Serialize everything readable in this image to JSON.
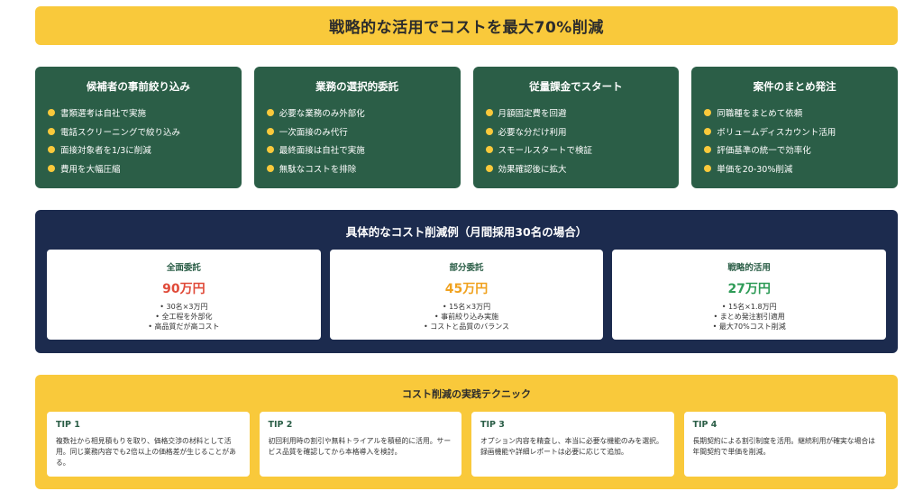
{
  "banner": {
    "title": "戦略的な活用でコストを最大70%削減"
  },
  "strategies": [
    {
      "title": "候補者の事前絞り込み",
      "items": [
        "書類選考は自社で実施",
        "電話スクリーニングで絞り込み",
        "面接対象者を1/3に削減",
        "費用を大幅圧縮"
      ]
    },
    {
      "title": "業務の選択的委託",
      "items": [
        "必要な業務のみ外部化",
        "一次面接のみ代行",
        "最終面接は自社で実施",
        "無駄なコストを排除"
      ]
    },
    {
      "title": "従量課金でスタート",
      "items": [
        "月額固定費を回避",
        "必要な分だけ利用",
        "スモールスタートで検証",
        "効果確認後に拡大"
      ]
    },
    {
      "title": "案件のまとめ発注",
      "items": [
        "同職種をまとめて依頼",
        "ボリュームディスカウント活用",
        "評価基準の統一で効率化",
        "単価を20-30%削減"
      ]
    }
  ],
  "examples": {
    "title": "具体的なコスト削減例（月間採用30名の場合）",
    "cards": [
      {
        "label": "全面委託",
        "price": "90万円",
        "price_color": "#e04b3a",
        "details": [
          "• 30名×3万円",
          "• 全工程を外部化",
          "• 高品質だが高コスト"
        ]
      },
      {
        "label": "部分委託",
        "price": "45万円",
        "price_color": "#f0a21f",
        "details": [
          "• 15名×3万円",
          "• 事前絞り込み実施",
          "• コストと品質のバランス"
        ]
      },
      {
        "label": "戦略的活用",
        "price": "27万円",
        "price_color": "#2e9b57",
        "details": [
          "• 15名×1.8万円",
          "• まとめ発注割引適用",
          "• 最大70%コスト削減"
        ]
      }
    ]
  },
  "techniques": {
    "title": "コスト削減の実践テクニック",
    "tips": [
      {
        "label": "TIP 1",
        "text": "複数社から相見積もりを取り、価格交渉の材料として活用。同じ業務内容でも2倍以上の価格差が生じることがある。"
      },
      {
        "label": "TIP 2",
        "text": "初回利用時の割引や無料トライアルを積極的に活用。サービス品質を確認してから本格導入を検討。"
      },
      {
        "label": "TIP 3",
        "text": "オプション内容を精査し、本当に必要な機能のみを選択。録画機能や詳細レポートは必要に応じて追加。"
      },
      {
        "label": "TIP 4",
        "text": "長期契約による割引制度を活用。継続利用が確実な場合は年間契約で単価を削減。"
      }
    ]
  },
  "colors": {
    "accent_yellow": "#f9c93b",
    "card_green": "#2b5e47",
    "panel_navy": "#1c2b4e"
  }
}
